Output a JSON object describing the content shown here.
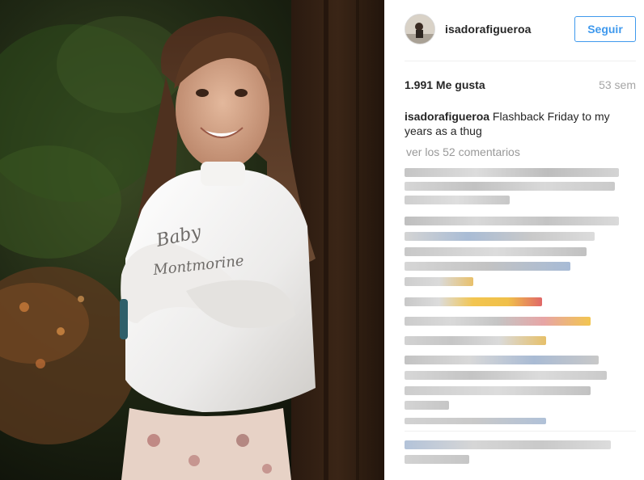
{
  "post": {
    "username": "isadorafigueroa",
    "follow_label": "Seguir",
    "likes": "1.991 Me gusta",
    "time": "53 sem",
    "caption_user": "isadorafigueroa",
    "caption_text": "Flashback Friday to my years as a thug",
    "view_all_comments": "ver los 52 comentarios"
  },
  "colors": {
    "accent": "#3f99ed",
    "text": "#262626",
    "muted": "#999999",
    "divider": "#efefef"
  }
}
